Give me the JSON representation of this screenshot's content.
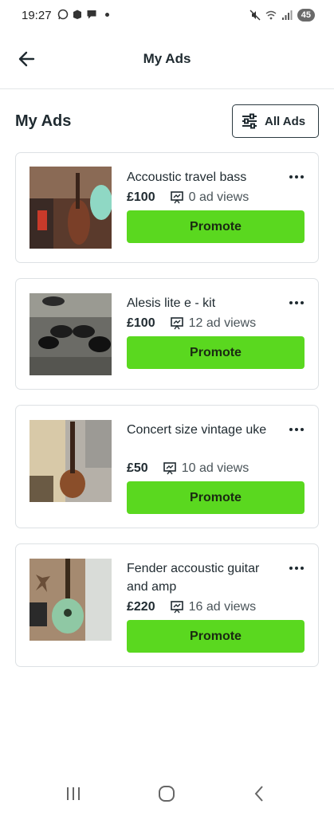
{
  "status_bar": {
    "time": "19:27",
    "battery": "45",
    "icons": [
      "whatsapp-icon",
      "box-icon",
      "chat-icon",
      "mute-icon",
      "wifi-icon",
      "signal-icon"
    ]
  },
  "app_bar": {
    "title": "My Ads",
    "back_icon": "arrow-left-icon"
  },
  "section": {
    "title": "My Ads",
    "filter_label": "All Ads",
    "filter_icon": "sliders-icon"
  },
  "ads": [
    {
      "title": "Accoustic travel bass",
      "price": "£100",
      "views": "0 ad views",
      "promote_label": "Promote"
    },
    {
      "title": "Alesis lite e - kit",
      "price": "£100",
      "views": "12 ad views",
      "promote_label": "Promote"
    },
    {
      "title": "Concert size vintage uke",
      "price": "£50",
      "views": "10 ad views",
      "promote_label": "Promote"
    },
    {
      "title": "Fender accoustic guitar and amp",
      "price": "£220",
      "views": "16 ad views",
      "promote_label": "Promote"
    }
  ],
  "colors": {
    "promote": "#5ad81f",
    "text": "#1f2a30",
    "border": "#dde1e4"
  }
}
